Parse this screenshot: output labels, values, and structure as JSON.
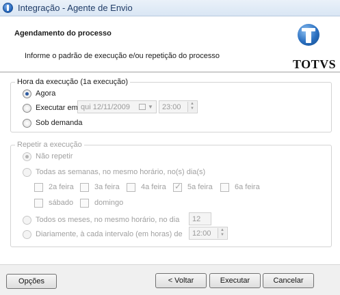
{
  "window": {
    "title": "Integração - Agente de Envio"
  },
  "header": {
    "title": "Agendamento do processo",
    "subtitle": "Informe o padrão de execução e/ou repetição do processo",
    "logo_text": "TOTVS"
  },
  "execution": {
    "legend": "Hora da execução (1a execução)",
    "options": [
      {
        "label": "Agora",
        "checked": true
      },
      {
        "label": "Executar em",
        "checked": false
      },
      {
        "label": "Sob demanda",
        "checked": false
      }
    ],
    "date_value": "qui 12/11/2009",
    "time_value": "23:00"
  },
  "repeat": {
    "legend": "Repetir a execução",
    "options": [
      {
        "label": "Não repetir",
        "checked": true
      },
      {
        "label": "Todas as semanas, no mesmo horário, no(s) dia(s)",
        "checked": false
      },
      {
        "label": "Todos os meses, no mesmo horário, no dia",
        "checked": false
      },
      {
        "label": "Diariamente, à cada intervalo (em horas) de",
        "checked": false
      }
    ],
    "days": [
      {
        "label": "2a feira",
        "checked": false
      },
      {
        "label": "3a feira",
        "checked": false
      },
      {
        "label": "4a feira",
        "checked": false
      },
      {
        "label": "5a feira",
        "checked": true
      },
      {
        "label": "6a feira",
        "checked": false
      },
      {
        "label": "sábado",
        "checked": false
      },
      {
        "label": "domingo",
        "checked": false
      }
    ],
    "month_day_value": "12",
    "interval_value": "12:00"
  },
  "footer": {
    "options_label": "Opções",
    "back_label": "< Voltar",
    "execute_label": "Executar",
    "cancel_label": "Cancelar"
  }
}
